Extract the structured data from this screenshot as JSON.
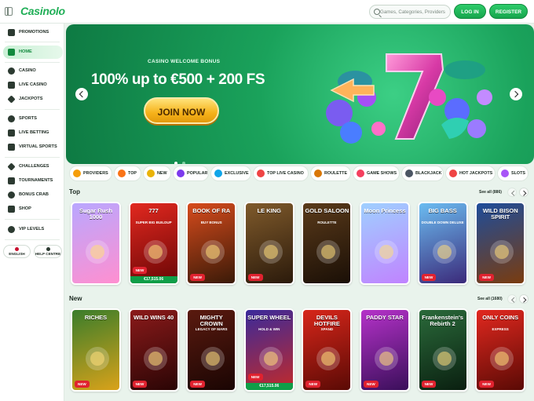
{
  "header": {
    "logo": "Casinolo",
    "search_placeholder": "Games, Categories, Providers",
    "login_label": "LOG IN",
    "register_label": "REGISTER"
  },
  "sidebar": {
    "items": [
      {
        "label": "PROMOTIONS",
        "icon": "gift-icon"
      },
      {
        "label": "HOME",
        "icon": "home-icon",
        "active": true
      },
      {
        "label": "CASINO",
        "icon": "casino-icon"
      },
      {
        "label": "LIVE CASINO",
        "icon": "live-casino-icon"
      },
      {
        "label": "JACKPOTS",
        "icon": "jackpot-icon"
      },
      {
        "label": "SPORTS",
        "icon": "sports-icon"
      },
      {
        "label": "LIVE BETTING",
        "icon": "live-betting-icon"
      },
      {
        "label": "VIRTUAL SPORTS",
        "icon": "virtual-sports-icon"
      },
      {
        "label": "CHALLENGES",
        "icon": "challenges-icon"
      },
      {
        "label": "TOURNAMENTS",
        "icon": "trophy-icon"
      },
      {
        "label": "BONUS CRAB",
        "icon": "crab-icon"
      },
      {
        "label": "SHOP",
        "icon": "shop-icon"
      },
      {
        "label": "VIP LEVELS",
        "icon": "vip-icon"
      }
    ],
    "language_label": "ENGLISH",
    "help_label": "HELP CENTRE"
  },
  "banner": {
    "tag": "CASINO WELCOME BONUS",
    "headline": "100% up to €500 + 200 FS",
    "cta": "JOIN NOW"
  },
  "categories": [
    {
      "label": "PROVIDERS",
      "color": "#f59e0b"
    },
    {
      "label": "TOP",
      "color": "#f97316"
    },
    {
      "label": "NEW",
      "color": "#eab308"
    },
    {
      "label": "POPULAR",
      "color": "#7c3aed"
    },
    {
      "label": "EXCLUSIVE",
      "color": "#0ea5e9"
    },
    {
      "label": "TOP LIVE CASINO",
      "color": "#ef4444"
    },
    {
      "label": "ROULETTE",
      "color": "#d97706"
    },
    {
      "label": "GAME SHOWS",
      "color": "#f43f5e"
    },
    {
      "label": "BLACKJACK",
      "color": "#4b5563"
    },
    {
      "label": "HOT JACKPOTS",
      "color": "#ef4444"
    },
    {
      "label": "SLOTS",
      "color": "#a855f7"
    }
  ],
  "sections": {
    "top": {
      "title": "Top",
      "see_all": "See all (886)",
      "games": [
        {
          "title": "Sugar Rush 1000",
          "sub": "",
          "bg1": "#b9a7ff",
          "bg2": "#ff8fd0",
          "badge": "",
          "jackpot": ""
        },
        {
          "title": "777",
          "sub": "SUPER BIG BUILDUP",
          "bg1": "#e2281f",
          "bg2": "#6a0606",
          "badge": "NEW",
          "jackpot": "€17,515.06"
        },
        {
          "title": "BOOK OF RA",
          "sub": "BUY BONUS",
          "bg1": "#d74b1c",
          "bg2": "#3a1a08",
          "badge": "NEW",
          "jackpot": ""
        },
        {
          "title": "LE KING",
          "sub": "",
          "bg1": "#7f5a2b",
          "bg2": "#2b1a0b",
          "badge": "NEW",
          "jackpot": ""
        },
        {
          "title": "GOLD SALOON",
          "sub": "ROULETTE",
          "bg1": "#5a3a1a",
          "bg2": "#1a0f06",
          "badge": "",
          "jackpot": ""
        },
        {
          "title": "Moon Princess",
          "sub": "",
          "bg1": "#9fd0ff",
          "bg2": "#c083ff",
          "badge": "",
          "jackpot": ""
        },
        {
          "title": "BIG BASS",
          "sub": "DOUBLE DOWN DELUXE",
          "bg1": "#6bbcf1",
          "bg2": "#3b2a7a",
          "badge": "NEW",
          "jackpot": ""
        },
        {
          "title": "WILD BISON SPIRIT",
          "sub": "",
          "bg1": "#1e4d9b",
          "bg2": "#7a3c0f",
          "badge": "NEW",
          "jackpot": ""
        }
      ]
    },
    "new": {
      "title": "New",
      "see_all": "See all (1680)",
      "games": [
        {
          "title": "RICHES",
          "sub": "",
          "bg1": "#3a7d2b",
          "bg2": "#d9a21a",
          "badge": "NEW",
          "jackpot": ""
        },
        {
          "title": "WILD WINS 40",
          "sub": "",
          "bg1": "#8b1a1a",
          "bg2": "#2a0505",
          "badge": "NEW",
          "jackpot": ""
        },
        {
          "title": "MIGHTY CROWN",
          "sub": "LEGACY OF MARS",
          "bg1": "#5a1a0f",
          "bg2": "#1a0503",
          "badge": "NEW",
          "jackpot": ""
        },
        {
          "title": "SUPER WHEEL",
          "sub": "HOLD & WIN",
          "bg1": "#3a2a9b",
          "bg2": "#c22a2a",
          "badge": "NEW",
          "jackpot": "€17,515.06"
        },
        {
          "title": "DEVILS HOTFIRE",
          "sub": "XPAND",
          "bg1": "#d7261a",
          "bg2": "#5a0a05",
          "badge": "NEW",
          "jackpot": ""
        },
        {
          "title": "PADDY STAR",
          "sub": "",
          "bg1": "#b532c9",
          "bg2": "#3a0f5a",
          "badge": "NEW",
          "jackpot": ""
        },
        {
          "title": "Frankenstein's Rebirth 2",
          "sub": "",
          "bg1": "#2a6a3a",
          "bg2": "#0a1f10",
          "badge": "NEW",
          "jackpot": ""
        },
        {
          "title": "ONLY COINS",
          "sub": "EXPRESS",
          "bg1": "#e2281f",
          "bg2": "#5a0a05",
          "badge": "NEW",
          "jackpot": ""
        }
      ]
    }
  }
}
